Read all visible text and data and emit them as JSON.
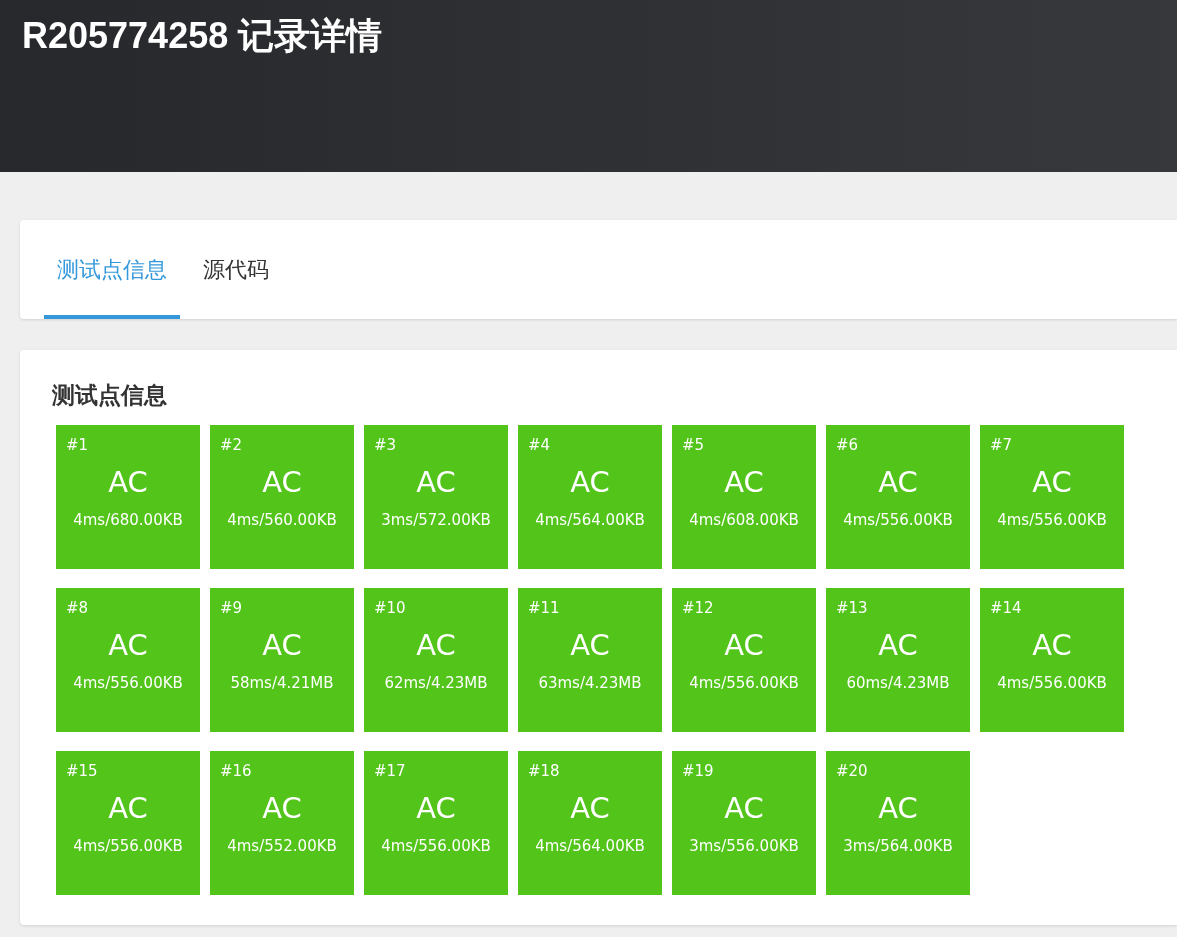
{
  "header": {
    "title": "R205774258 记录详情"
  },
  "tabs": [
    {
      "label": "测试点信息",
      "selected": true
    },
    {
      "label": "源代码",
      "selected": false
    }
  ],
  "testcases": {
    "title": "测试点信息",
    "items": [
      {
        "id": "#1",
        "status": "AC",
        "stats": "4ms/680.00KB"
      },
      {
        "id": "#2",
        "status": "AC",
        "stats": "4ms/560.00KB"
      },
      {
        "id": "#3",
        "status": "AC",
        "stats": "3ms/572.00KB"
      },
      {
        "id": "#4",
        "status": "AC",
        "stats": "4ms/564.00KB"
      },
      {
        "id": "#5",
        "status": "AC",
        "stats": "4ms/608.00KB"
      },
      {
        "id": "#6",
        "status": "AC",
        "stats": "4ms/556.00KB"
      },
      {
        "id": "#7",
        "status": "AC",
        "stats": "4ms/556.00KB"
      },
      {
        "id": "#8",
        "status": "AC",
        "stats": "4ms/556.00KB"
      },
      {
        "id": "#9",
        "status": "AC",
        "stats": "58ms/4.21MB"
      },
      {
        "id": "#10",
        "status": "AC",
        "stats": "62ms/4.23MB"
      },
      {
        "id": "#11",
        "status": "AC",
        "stats": "63ms/4.23MB"
      },
      {
        "id": "#12",
        "status": "AC",
        "stats": "4ms/556.00KB"
      },
      {
        "id": "#13",
        "status": "AC",
        "stats": "60ms/4.23MB"
      },
      {
        "id": "#14",
        "status": "AC",
        "stats": "4ms/556.00KB"
      },
      {
        "id": "#15",
        "status": "AC",
        "stats": "4ms/556.00KB"
      },
      {
        "id": "#16",
        "status": "AC",
        "stats": "4ms/552.00KB"
      },
      {
        "id": "#17",
        "status": "AC",
        "stats": "4ms/556.00KB"
      },
      {
        "id": "#18",
        "status": "AC",
        "stats": "4ms/564.00KB"
      },
      {
        "id": "#19",
        "status": "AC",
        "stats": "3ms/556.00KB"
      },
      {
        "id": "#20",
        "status": "AC",
        "stats": "3ms/564.00KB"
      }
    ]
  }
}
